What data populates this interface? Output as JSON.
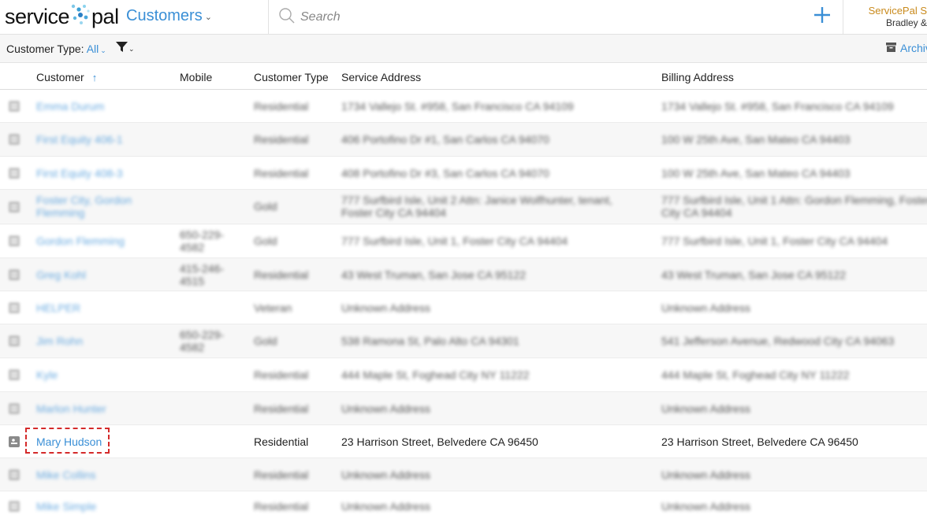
{
  "header": {
    "logo_left": "service",
    "logo_right": "pal",
    "section_title": "Customers",
    "search_placeholder": "Search",
    "account_company": "ServicePal S",
    "account_user": "Bradley &"
  },
  "filters": {
    "customer_type_label": "Customer Type:",
    "customer_type_value": "All",
    "archive_label": "Archiv"
  },
  "columns": {
    "customer": "Customer",
    "mobile": "Mobile",
    "customer_type": "Customer Type",
    "service_address": "Service Address",
    "billing_address": "Billing Address"
  },
  "colors": {
    "link": "#3a8fd6",
    "company": "#c98a1c",
    "highlight": "#d42a2a"
  },
  "rows": [
    {
      "name": "Emma Durum",
      "mobile": "",
      "type": "Residential",
      "service": "1734 Vallejo St. #958, San Francisco CA 94109",
      "billing": "1734 Vallejo St. #958, San Francisco CA 94109"
    },
    {
      "name": "First Equity 406-1",
      "mobile": "",
      "type": "Residential",
      "service": "406 Portofino Dr #1, San Carlos CA 94070",
      "billing": "100 W 25th Ave, San Mateo CA 94403"
    },
    {
      "name": "First Equity 408-3",
      "mobile": "",
      "type": "Residential",
      "service": "408 Portofino Dr #3, San Carlos CA 94070",
      "billing": "100 W 25th Ave, San Mateo CA 94403"
    },
    {
      "name": "Foster City, Gordon Flemming",
      "mobile": "",
      "type": "Gold",
      "service": "777 Surfbird Isle, Unit 2 Attn: Janice Wolfhunter, tenant, Foster City CA 94404",
      "billing": "777 Surfbird Isle, Unit 1 Attn: Gordon Flemming, Foster City CA 94404"
    },
    {
      "name": "Gordon Flemming",
      "mobile": "650-229-4582",
      "type": "Gold",
      "service": "777 Surfbird Isle, Unit 1, Foster City CA 94404",
      "billing": "777 Surfbird Isle, Unit 1, Foster City CA 94404"
    },
    {
      "name": "Greg Kohl",
      "mobile": "415-246-4515",
      "type": "Residential",
      "service": "43 West Truman, San Jose CA 95122",
      "billing": "43 West Truman, San Jose CA 95122"
    },
    {
      "name": "HELPER",
      "mobile": "",
      "type": "Veteran",
      "service": "Unknown Address",
      "billing": "Unknown Address"
    },
    {
      "name": "Jim Rohn",
      "mobile": "650-229-4582",
      "type": "Gold",
      "service": "538 Ramona St, Palo Alto CA 94301",
      "billing": "541 Jefferson Avenue, Redwood City CA 94063"
    },
    {
      "name": "Kyle",
      "mobile": "",
      "type": "Residential",
      "service": "444 Maple St, Foghead City NY 11222",
      "billing": "444 Maple St, Foghead City NY 11222"
    },
    {
      "name": "Marlon Hunter",
      "mobile": "",
      "type": "Residential",
      "service": "Unknown Address",
      "billing": "Unknown Address"
    },
    {
      "name": "Mary Hudson",
      "mobile": "",
      "type": "Residential",
      "service": "23 Harrison Street, Belvedere CA 96450",
      "billing": "23 Harrison Street, Belvedere CA 96450"
    },
    {
      "name": "Mike Collins",
      "mobile": "",
      "type": "Residential",
      "service": "Unknown Address",
      "billing": "Unknown Address"
    },
    {
      "name": "Mike Simple",
      "mobile": "",
      "type": "Residential",
      "service": "Unknown Address",
      "billing": "Unknown Address"
    }
  ]
}
